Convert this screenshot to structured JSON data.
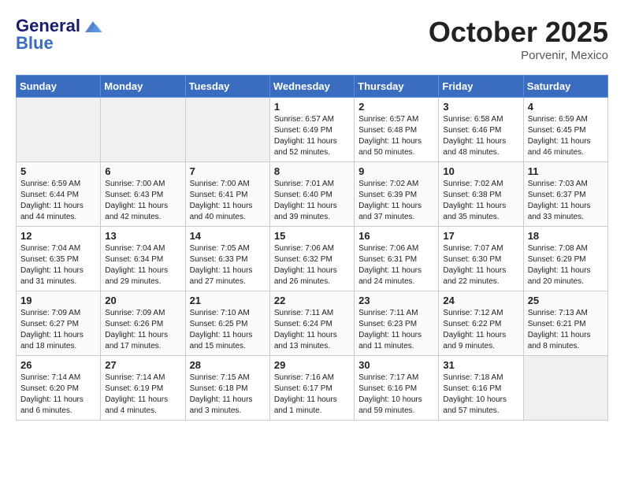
{
  "header": {
    "logo_line1": "General",
    "logo_line2": "Blue",
    "month": "October 2025",
    "location": "Porvenir, Mexico"
  },
  "days_of_week": [
    "Sunday",
    "Monday",
    "Tuesday",
    "Wednesday",
    "Thursday",
    "Friday",
    "Saturday"
  ],
  "weeks": [
    [
      {
        "day": "",
        "info": "",
        "shaded": true
      },
      {
        "day": "",
        "info": "",
        "shaded": true
      },
      {
        "day": "",
        "info": "",
        "shaded": true
      },
      {
        "day": "1",
        "info": "Sunrise: 6:57 AM\nSunset: 6:49 PM\nDaylight: 11 hours\nand 52 minutes."
      },
      {
        "day": "2",
        "info": "Sunrise: 6:57 AM\nSunset: 6:48 PM\nDaylight: 11 hours\nand 50 minutes."
      },
      {
        "day": "3",
        "info": "Sunrise: 6:58 AM\nSunset: 6:46 PM\nDaylight: 11 hours\nand 48 minutes."
      },
      {
        "day": "4",
        "info": "Sunrise: 6:59 AM\nSunset: 6:45 PM\nDaylight: 11 hours\nand 46 minutes."
      }
    ],
    [
      {
        "day": "5",
        "info": "Sunrise: 6:59 AM\nSunset: 6:44 PM\nDaylight: 11 hours\nand 44 minutes."
      },
      {
        "day": "6",
        "info": "Sunrise: 7:00 AM\nSunset: 6:43 PM\nDaylight: 11 hours\nand 42 minutes."
      },
      {
        "day": "7",
        "info": "Sunrise: 7:00 AM\nSunset: 6:41 PM\nDaylight: 11 hours\nand 40 minutes."
      },
      {
        "day": "8",
        "info": "Sunrise: 7:01 AM\nSunset: 6:40 PM\nDaylight: 11 hours\nand 39 minutes."
      },
      {
        "day": "9",
        "info": "Sunrise: 7:02 AM\nSunset: 6:39 PM\nDaylight: 11 hours\nand 37 minutes."
      },
      {
        "day": "10",
        "info": "Sunrise: 7:02 AM\nSunset: 6:38 PM\nDaylight: 11 hours\nand 35 minutes."
      },
      {
        "day": "11",
        "info": "Sunrise: 7:03 AM\nSunset: 6:37 PM\nDaylight: 11 hours\nand 33 minutes."
      }
    ],
    [
      {
        "day": "12",
        "info": "Sunrise: 7:04 AM\nSunset: 6:35 PM\nDaylight: 11 hours\nand 31 minutes."
      },
      {
        "day": "13",
        "info": "Sunrise: 7:04 AM\nSunset: 6:34 PM\nDaylight: 11 hours\nand 29 minutes."
      },
      {
        "day": "14",
        "info": "Sunrise: 7:05 AM\nSunset: 6:33 PM\nDaylight: 11 hours\nand 27 minutes."
      },
      {
        "day": "15",
        "info": "Sunrise: 7:06 AM\nSunset: 6:32 PM\nDaylight: 11 hours\nand 26 minutes."
      },
      {
        "day": "16",
        "info": "Sunrise: 7:06 AM\nSunset: 6:31 PM\nDaylight: 11 hours\nand 24 minutes."
      },
      {
        "day": "17",
        "info": "Sunrise: 7:07 AM\nSunset: 6:30 PM\nDaylight: 11 hours\nand 22 minutes."
      },
      {
        "day": "18",
        "info": "Sunrise: 7:08 AM\nSunset: 6:29 PM\nDaylight: 11 hours\nand 20 minutes."
      }
    ],
    [
      {
        "day": "19",
        "info": "Sunrise: 7:09 AM\nSunset: 6:27 PM\nDaylight: 11 hours\nand 18 minutes."
      },
      {
        "day": "20",
        "info": "Sunrise: 7:09 AM\nSunset: 6:26 PM\nDaylight: 11 hours\nand 17 minutes."
      },
      {
        "day": "21",
        "info": "Sunrise: 7:10 AM\nSunset: 6:25 PM\nDaylight: 11 hours\nand 15 minutes."
      },
      {
        "day": "22",
        "info": "Sunrise: 7:11 AM\nSunset: 6:24 PM\nDaylight: 11 hours\nand 13 minutes."
      },
      {
        "day": "23",
        "info": "Sunrise: 7:11 AM\nSunset: 6:23 PM\nDaylight: 11 hours\nand 11 minutes."
      },
      {
        "day": "24",
        "info": "Sunrise: 7:12 AM\nSunset: 6:22 PM\nDaylight: 11 hours\nand 9 minutes."
      },
      {
        "day": "25",
        "info": "Sunrise: 7:13 AM\nSunset: 6:21 PM\nDaylight: 11 hours\nand 8 minutes."
      }
    ],
    [
      {
        "day": "26",
        "info": "Sunrise: 7:14 AM\nSunset: 6:20 PM\nDaylight: 11 hours\nand 6 minutes."
      },
      {
        "day": "27",
        "info": "Sunrise: 7:14 AM\nSunset: 6:19 PM\nDaylight: 11 hours\nand 4 minutes."
      },
      {
        "day": "28",
        "info": "Sunrise: 7:15 AM\nSunset: 6:18 PM\nDaylight: 11 hours\nand 3 minutes."
      },
      {
        "day": "29",
        "info": "Sunrise: 7:16 AM\nSunset: 6:17 PM\nDaylight: 11 hours\nand 1 minute."
      },
      {
        "day": "30",
        "info": "Sunrise: 7:17 AM\nSunset: 6:16 PM\nDaylight: 10 hours\nand 59 minutes."
      },
      {
        "day": "31",
        "info": "Sunrise: 7:18 AM\nSunset: 6:16 PM\nDaylight: 10 hours\nand 57 minutes."
      },
      {
        "day": "",
        "info": "",
        "shaded": true
      }
    ]
  ]
}
